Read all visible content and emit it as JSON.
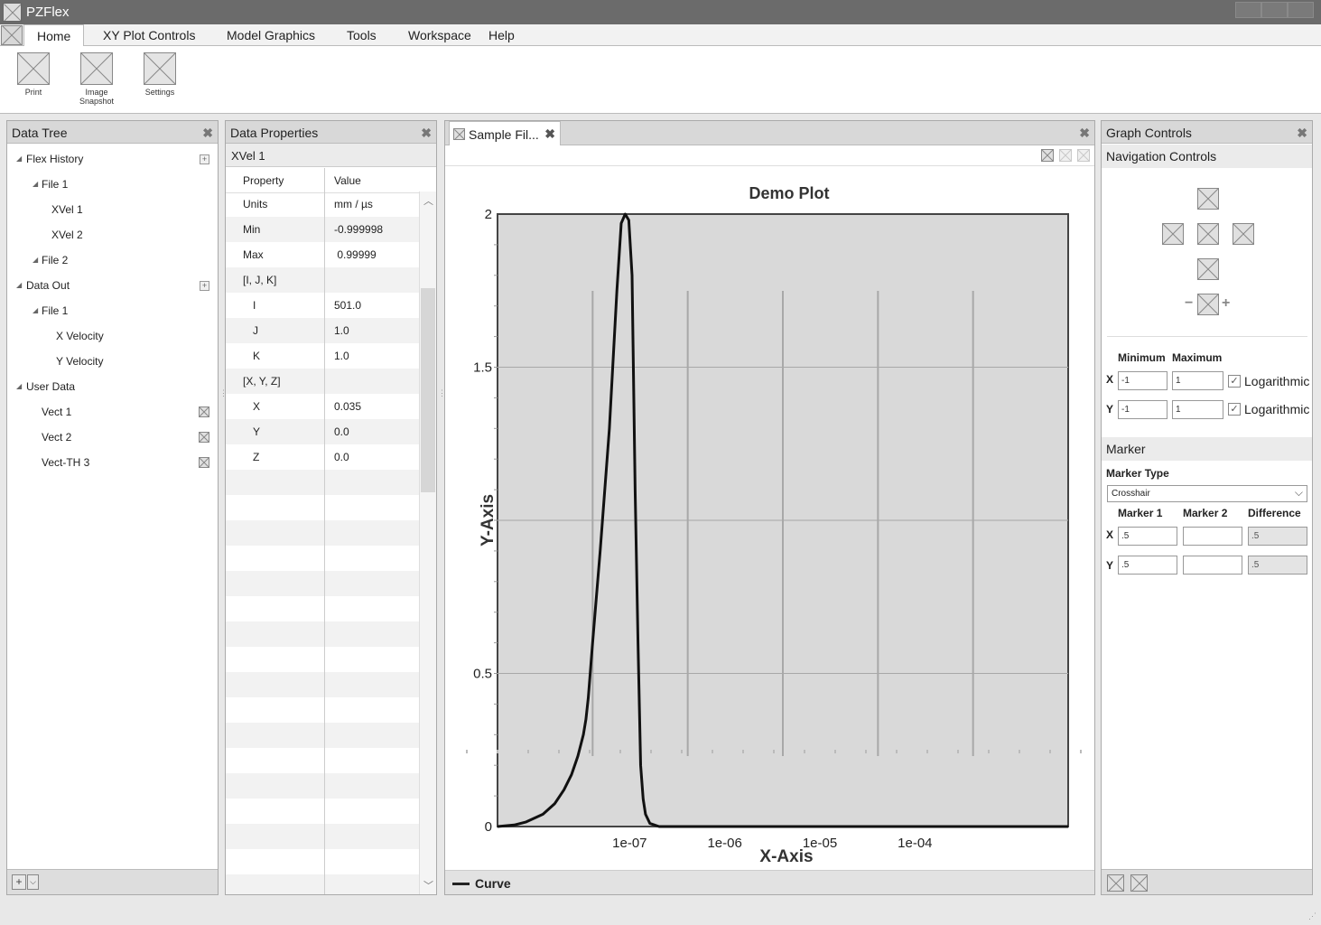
{
  "app": {
    "title": "PZFlex"
  },
  "menu": {
    "tabs": [
      "Home",
      "XY Plot Controls",
      "Model Graphics",
      "Tools",
      "Workspace",
      "Help"
    ]
  },
  "ribbon": {
    "print": "Print",
    "snapshot": "Image Snapshot",
    "settings": "Settings"
  },
  "data_tree": {
    "title": "Data Tree",
    "items": [
      {
        "label": "Flex History",
        "level": 0,
        "expanded": true,
        "action": "add"
      },
      {
        "label": "File 1",
        "level": 1,
        "expanded": true
      },
      {
        "label": "XVel 1",
        "level": 2
      },
      {
        "label": "XVel 2",
        "level": 2
      },
      {
        "label": "File 2",
        "level": 1,
        "expanded": true
      },
      {
        "label": "Data Out",
        "level": 0,
        "expanded": true,
        "action": "add"
      },
      {
        "label": "File 1",
        "level": 1,
        "expanded": true
      },
      {
        "label": "X Velocity",
        "level": 2
      },
      {
        "label": "Y Velocity",
        "level": 2
      },
      {
        "label": "User Data",
        "level": 0,
        "expanded": true
      },
      {
        "label": "Vect 1",
        "level": 1,
        "action": "remove"
      },
      {
        "label": "Vect 2",
        "level": 1,
        "action": "remove"
      },
      {
        "label": "Vect-TH 3",
        "level": 1,
        "action": "remove"
      }
    ],
    "footer": {
      "add_label": "+",
      "dropdown_label": "v"
    }
  },
  "data_properties": {
    "title": "Data Properties",
    "selected": "XVel 1",
    "headers": {
      "property": "Property",
      "value": "Value"
    },
    "rows": [
      {
        "property": "Units",
        "value": "mm / µs",
        "indent": false
      },
      {
        "property": "Min",
        "value": "-0.999998",
        "indent": false
      },
      {
        "property": "Max",
        "value": " 0.99999",
        "indent": false
      },
      {
        "property": "[I, J, K]",
        "value": "",
        "indent": false
      },
      {
        "property": "I",
        "value": "501.0",
        "indent": true
      },
      {
        "property": "J",
        "value": "1.0",
        "indent": true
      },
      {
        "property": "K",
        "value": "1.0",
        "indent": true
      },
      {
        "property": "[X, Y, Z]",
        "value": "",
        "indent": false
      },
      {
        "property": "X",
        "value": "0.035",
        "indent": true
      },
      {
        "property": "Y",
        "value": "0.0",
        "indent": true
      },
      {
        "property": "Z",
        "value": "0.0",
        "indent": true
      }
    ]
  },
  "plot": {
    "tab_label": "Sample Fil...",
    "legend_label": "Curve"
  },
  "chart_data": {
    "type": "line",
    "title": "Demo Plot",
    "xlabel": "X-Axis",
    "ylabel": "Y-Axis",
    "x_scale": "log",
    "xlim": [
      1e-08,
      0.01
    ],
    "ylim": [
      0,
      2
    ],
    "x_tick_labels": [
      "1e-07",
      "1e-06",
      "1e-05",
      "1e-04"
    ],
    "y_tick_labels": [
      "0",
      "0.5",
      "1.5",
      "2"
    ],
    "y_ticks": [
      0,
      0.5,
      1.5,
      2
    ],
    "grid": true,
    "legend": "bottom",
    "series": [
      {
        "name": "Curve",
        "x": [
          1e-08,
          1.5e-08,
          2e-08,
          3e-08,
          4e-08,
          5e-08,
          6e-08,
          7e-08,
          8e-08,
          8.5e-08,
          9e-08,
          1e-07,
          1.2e-07,
          1.5e-07,
          1.8e-07,
          2e-07,
          2.2e-07,
          2.4e-07,
          2.6e-07,
          2.8e-07,
          3e-07,
          3.2e-07,
          3.4e-07,
          3.6e-07,
          4e-07,
          5e-07,
          1e-06,
          1e-05,
          0.0001,
          0.01
        ],
        "y": [
          0.0,
          0.005,
          0.015,
          0.04,
          0.075,
          0.12,
          0.17,
          0.23,
          0.3,
          0.35,
          0.42,
          0.6,
          0.9,
          1.3,
          1.75,
          1.97,
          2.0,
          1.98,
          1.8,
          1.1,
          0.6,
          0.2,
          0.09,
          0.04,
          0.01,
          0.0,
          0.0,
          0.0,
          0.0,
          0.0
        ]
      }
    ],
    "colors": {
      "line": "#111111",
      "plot_bg": "#d9d9d9",
      "grid": "#a8a8a8"
    }
  },
  "graph_controls": {
    "title": "Graph Controls",
    "navigation_title": "Navigation Controls",
    "zoom_minus": "−",
    "zoom_plus": "+",
    "range": {
      "min_label": "Minimum",
      "max_label": "Maximum",
      "x_label": "X",
      "y_label": "Y",
      "x_min": "-1",
      "x_max": "1",
      "y_min": "-1",
      "y_max": "1",
      "x_log_label": "Logarithmic",
      "y_log_label": "Logarithmic",
      "x_log": true,
      "y_log": true
    },
    "marker": {
      "title": "Marker",
      "type_label": "Marker Type",
      "type_value": "Crosshair",
      "col1": "Marker 1",
      "col2": "Marker 2",
      "col3": "Difference",
      "x_label": "X",
      "y_label": "Y",
      "x1": ".5",
      "x2": "",
      "xdiff": ".5",
      "y1": ".5",
      "y2": "",
      "ydiff": ".5"
    }
  }
}
